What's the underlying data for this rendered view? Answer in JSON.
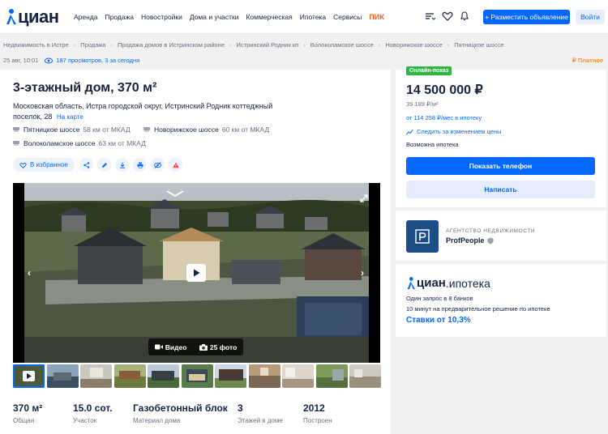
{
  "header": {
    "logo_text": "циан",
    "nav": [
      "Аренда",
      "Продажа",
      "Новостройки",
      "Дома и участки",
      "Коммерческая",
      "Ипотека",
      "Сервисы"
    ],
    "nav_brand": "ПИК",
    "post_button": "+ Разместить объявление",
    "login_button": "Войти"
  },
  "breadcrumbs": [
    "Недвижимость в Истре",
    "Продажа",
    "Продажа домов в Истринском районе",
    "Истринский Родник кп",
    "Волоколамское шоссе",
    "Новорижское шоссе",
    "Пятницкое шоссе"
  ],
  "meta": {
    "date": "25 авг, 10:01",
    "views": "187 просмотров, 3 за сегодня",
    "paid": "Платное"
  },
  "listing": {
    "title": "3-этажный дом, 370 м²",
    "address": "Московская область, Истра городской округ, Истринский Родник коттеджный поселок, 28",
    "map_link": "На карте",
    "highways": [
      {
        "name": "Пятницкое шоссе",
        "distance": "58 км от МКАД"
      },
      {
        "name": "Новорижское шоссе",
        "distance": "60 км от МКАД"
      },
      {
        "name": "Волоколамское шоссе",
        "distance": "63 км от МКАД"
      }
    ],
    "favorite": "В избранное",
    "media": {
      "video": "Видео",
      "photos": "25 фото"
    },
    "specs": [
      {
        "value": "370 м²",
        "label": "Общая"
      },
      {
        "value": "15.0 сот.",
        "label": "Участок"
      },
      {
        "value": "Газобетонный блок",
        "label": "Материал дома"
      },
      {
        "value": "3",
        "label": "Этажей в доме"
      },
      {
        "value": "2012",
        "label": "Построен"
      }
    ]
  },
  "sidebar": {
    "badge": "Онлайн-показ",
    "price": "14 500 000 ₽",
    "price_per_m2": "39 189 ₽/м²",
    "mortgage_link": "от 114 258 ₽/мес в ипотеку",
    "follow": "Следить за изменением цены",
    "mortgage_possible": "Возможна ипотека",
    "phone_button": "Показать телефон",
    "write_button": "Написать"
  },
  "agency": {
    "type": "АГЕНТСТВО НЕДВИЖИМОСТИ",
    "name": "ProfPeople"
  },
  "ipoteka": {
    "logo_brand": "циан",
    "logo_suffix": ".ипотека",
    "line1": "Один запрос в 8 банков",
    "line2": "10 минут на предварительное решение по ипотеке",
    "rate": "Ставки от 10,3%"
  },
  "colors": {
    "accent": "#0468ff",
    "brand": "#152242",
    "online": "#2fb541",
    "paid": "#ff8d1f",
    "pik": "#ff5a1f"
  }
}
